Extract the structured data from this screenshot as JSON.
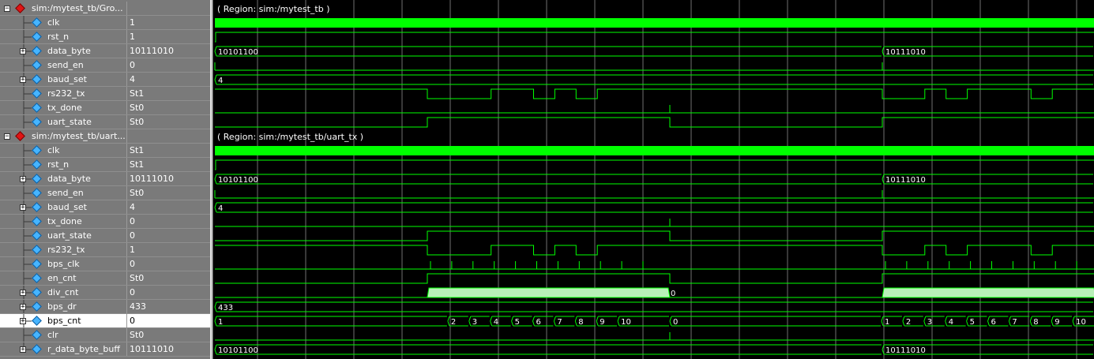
{
  "colors": {
    "wave": "#00ff00",
    "analog_fill": "#b8f0b8",
    "grid": "#6f6f6f",
    "panel_bg": "#7a7a7a"
  },
  "groups": [
    {
      "label": "sim:/mytest_tb/Gro...",
      "region": "( Region: sim:/mytest_tb )"
    },
    {
      "label": "sim:/mytest_tb/uart...",
      "region": "( Region: sim:/mytest_tb/uart_tx )"
    }
  ],
  "signals": [
    {
      "name": "clk",
      "value": "1",
      "group": 0,
      "expandable": false
    },
    {
      "name": "rst_n",
      "value": "1",
      "group": 0,
      "expandable": false
    },
    {
      "name": "data_byte",
      "value": "10111010",
      "group": 0,
      "expandable": true
    },
    {
      "name": "send_en",
      "value": "0",
      "group": 0,
      "expandable": false
    },
    {
      "name": "baud_set",
      "value": "4",
      "group": 0,
      "expandable": true
    },
    {
      "name": "rs232_tx",
      "value": "St1",
      "group": 0,
      "expandable": false
    },
    {
      "name": "tx_done",
      "value": "St0",
      "group": 0,
      "expandable": false
    },
    {
      "name": "uart_state",
      "value": "St0",
      "group": 0,
      "expandable": false
    },
    {
      "name": "clk",
      "value": "St1",
      "group": 1,
      "expandable": false
    },
    {
      "name": "rst_n",
      "value": "St1",
      "group": 1,
      "expandable": false
    },
    {
      "name": "data_byte",
      "value": "10111010",
      "group": 1,
      "expandable": true
    },
    {
      "name": "send_en",
      "value": "St0",
      "group": 1,
      "expandable": false
    },
    {
      "name": "baud_set",
      "value": "4",
      "group": 1,
      "expandable": true
    },
    {
      "name": "tx_done",
      "value": "0",
      "group": 1,
      "expandable": false
    },
    {
      "name": "uart_state",
      "value": "0",
      "group": 1,
      "expandable": false
    },
    {
      "name": "rs232_tx",
      "value": "1",
      "group": 1,
      "expandable": false
    },
    {
      "name": "bps_clk",
      "value": "0",
      "group": 1,
      "expandable": false
    },
    {
      "name": "en_cnt",
      "value": "St0",
      "group": 1,
      "expandable": false
    },
    {
      "name": "div_cnt",
      "value": "0",
      "group": 1,
      "expandable": true
    },
    {
      "name": "bps_dr",
      "value": "433",
      "group": 1,
      "expandable": true
    },
    {
      "name": "bps_cnt",
      "value": "0",
      "group": 1,
      "expandable": true,
      "selected": true
    },
    {
      "name": "clr",
      "value": "St0",
      "group": 1,
      "expandable": false
    },
    {
      "name": "r_data_byte_buff",
      "value": "10111010",
      "group": 1,
      "expandable": true
    }
  ],
  "bus_values": {
    "data_byte": [
      "10101100",
      "10111010"
    ],
    "baud_set": "4",
    "bps_dr": "433",
    "div_cnt_end": "0",
    "bps_cnt": [
      "1",
      "2",
      "3",
      "4",
      "5",
      "6",
      "7",
      "8",
      "9",
      "10",
      "0"
    ]
  }
}
